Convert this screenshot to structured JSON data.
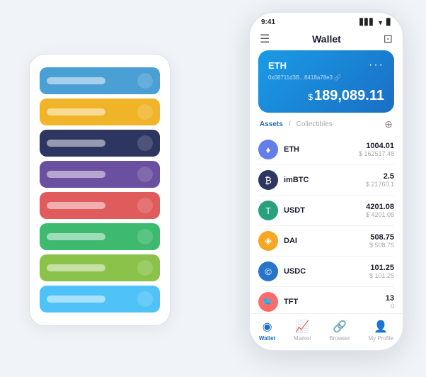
{
  "scene": {
    "background": "#f0f4f8"
  },
  "cardStack": {
    "cards": [
      {
        "color": "#4a9fd4",
        "barColor": "#fff",
        "iconColor": "#fff"
      },
      {
        "color": "#f0b429",
        "barColor": "#fff",
        "iconColor": "#fff"
      },
      {
        "color": "#2d3561",
        "barColor": "#fff",
        "iconColor": "#fff"
      },
      {
        "color": "#6b4fa0",
        "barColor": "#fff",
        "iconColor": "#fff"
      },
      {
        "color": "#e05c5c",
        "barColor": "#fff",
        "iconColor": "#fff"
      },
      {
        "color": "#3dba6f",
        "barColor": "#fff",
        "iconColor": "#fff"
      },
      {
        "color": "#8bc34a",
        "barColor": "#fff",
        "iconColor": "#fff"
      },
      {
        "color": "#4fc3f7",
        "barColor": "#fff",
        "iconColor": "#fff"
      }
    ]
  },
  "phone": {
    "statusBar": {
      "time": "9:41",
      "signal": "▋▋▋",
      "wifi": "◀",
      "battery": "▊"
    },
    "header": {
      "menuIcon": "☰",
      "title": "Wallet",
      "scanIcon": "⊡"
    },
    "ethCard": {
      "label": "ETH",
      "dotsLabel": "...",
      "address": "0x08711d3B...8418a78e3 🔗",
      "amountPrefix": "$",
      "amount": "189,089.11"
    },
    "assets": {
      "activeTab": "Assets",
      "separator": "/",
      "inactiveTab": "Collectibles",
      "addIcon": "⊕"
    },
    "assetList": [
      {
        "icon": "♦",
        "iconBg": "#627eea",
        "iconColor": "#fff",
        "name": "ETH",
        "amount": "1004.01",
        "usd": "$ 162517.48"
      },
      {
        "icon": "₿",
        "iconBg": "#2d3561",
        "iconColor": "#fff",
        "name": "imBTC",
        "amount": "2.5",
        "usd": "$ 21760.1"
      },
      {
        "icon": "T",
        "iconBg": "#26a17b",
        "iconColor": "#fff",
        "name": "USDT",
        "amount": "4201.08",
        "usd": "$ 4201.08"
      },
      {
        "icon": "◈",
        "iconBg": "#f5a623",
        "iconColor": "#fff",
        "name": "DAI",
        "amount": "508.75",
        "usd": "$ 508.75"
      },
      {
        "icon": "©",
        "iconBg": "#2775ca",
        "iconColor": "#fff",
        "name": "USDC",
        "amount": "101.25",
        "usd": "$ 101.25"
      },
      {
        "icon": "🐦",
        "iconBg": "#ff6b6b",
        "iconColor": "#fff",
        "name": "TFT",
        "amount": "13",
        "usd": "0"
      }
    ],
    "nav": [
      {
        "icon": "◉",
        "label": "Wallet",
        "active": true
      },
      {
        "icon": "📈",
        "label": "Market",
        "active": false
      },
      {
        "icon": "🔗",
        "label": "Browser",
        "active": false
      },
      {
        "icon": "👤",
        "label": "My Profile",
        "active": false
      }
    ]
  }
}
